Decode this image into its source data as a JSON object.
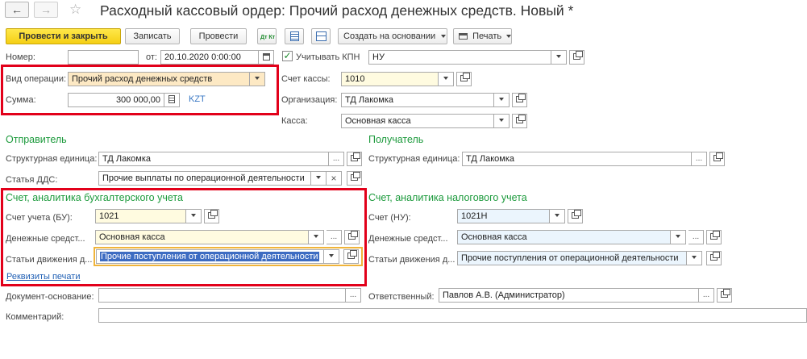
{
  "window": {
    "title": "Расходный кассовый ордер: Прочий расход денежных средств. Новый *",
    "star": "☆"
  },
  "toolbar": {
    "post_close": "Провести и закрыть",
    "save": "Записать",
    "post": "Провести",
    "dt_kt": "Дт Кт",
    "create_based": "Создать на основании",
    "print": "Печать"
  },
  "header": {
    "number_label": "Номер:",
    "number_value": "",
    "date_label": "от:",
    "date_value": "20.10.2020  0:00:00",
    "kpn_label": "Учитывать КПН",
    "kpn_checked": "✓",
    "kpn_value": "НУ"
  },
  "operation": {
    "type_label": "Вид операции:",
    "type_value": "Прочий расход денежных средств",
    "sum_label": "Сумма:",
    "sum_value": "300 000,00",
    "currency": "KZT"
  },
  "right_fields": {
    "cash_account_label": "Счет кассы:",
    "cash_account_value": "1010",
    "org_label": "Организация:",
    "org_value": "ТД Лакомка",
    "cashbox_label": "Касса:",
    "cashbox_value": "Основная касса"
  },
  "sender": {
    "title": "Отправитель",
    "unit_label": "Структурная единица:",
    "unit_value": "ТД Лакомка",
    "dds_label": "Статья ДДС:",
    "dds_value": "Прочие выплаты по операционной деятельности"
  },
  "receiver": {
    "title": "Получатель",
    "unit_label": "Структурная единица:",
    "unit_value": "ТД Лакомка"
  },
  "bu": {
    "title": "Счет, аналитика бухгалтерского учета",
    "account_label": "Счет учета (БУ):",
    "account_value": "1021",
    "money_label": "Денежные средст...",
    "money_value": "Основная касса",
    "movement_label": "Статьи движения д...",
    "movement_value": "Прочие поступления от операционной деятельности",
    "print_link": "Реквизиты печати"
  },
  "nu": {
    "title": "Счет, аналитика налогового учета",
    "account_label": "Счет (НУ):",
    "account_value": "1021Н",
    "money_label": "Денежные средст...",
    "money_value": "Основная касса",
    "movement_label": "Статьи движения д...",
    "movement_value": "Прочие поступления от операционной деятельности"
  },
  "footer": {
    "basis_label": "Документ-основание:",
    "basis_value": "",
    "responsible_label": "Ответственный:",
    "responsible_value": "Павлов А.В. (Администратор)",
    "comment_label": "Комментарий:",
    "comment_value": ""
  },
  "glyphs": {
    "back": "←",
    "forward": "→",
    "dots": "...",
    "clear": "×"
  }
}
